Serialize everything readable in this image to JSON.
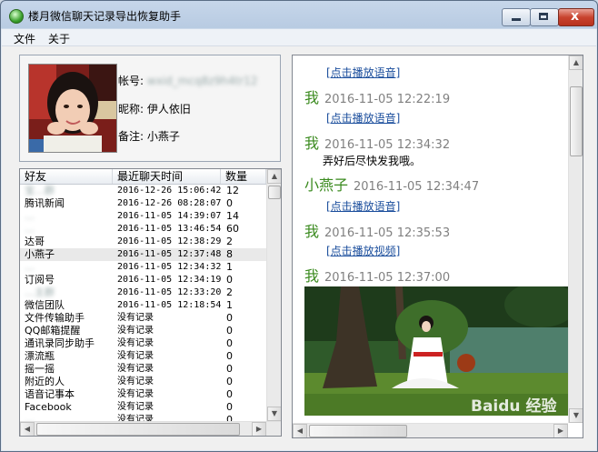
{
  "window": {
    "title": "楼月微信聊天记录导出恢复助手",
    "min_glyph": "",
    "max_glyph": "",
    "close_glyph": "x"
  },
  "menu": [
    "文件",
    "关于"
  ],
  "profile": {
    "account_label": "帐号:",
    "account_value": "wxid_mcq8z9h4tr12",
    "nickname_label": "昵称:",
    "nickname_value": "伊人依旧",
    "remark_label": "备注:",
    "remark_value": "小燕子"
  },
  "friend_list": {
    "columns": [
      "好友",
      "最近聊天时间",
      "数量"
    ],
    "rows": [
      {
        "name": "宝…群",
        "time": "2016-12-26 15:06:42",
        "count": "12",
        "blurred": true
      },
      {
        "name": "腾讯新闻",
        "time": "2016-12-26 08:28:07",
        "count": "0",
        "blurred": false
      },
      {
        "name": "…",
        "time": "2016-11-05 14:39:07",
        "count": "14",
        "blurred": true
      },
      {
        "name": "…",
        "time": "2016-11-05 13:46:54",
        "count": "60",
        "blurred": true
      },
      {
        "name": "达哥",
        "time": "2016-11-05 12:38:29",
        "count": "2",
        "blurred": false
      },
      {
        "name": "小燕子",
        "time": "2016-11-05 12:37:48",
        "count": "8",
        "blurred": false,
        "selected": true
      },
      {
        "name": "…",
        "time": "2016-11-05 12:34:32",
        "count": "1",
        "blurred": true
      },
      {
        "name": "订阅号",
        "time": "2016-11-05 12:34:19",
        "count": "0",
        "blurred": false
      },
      {
        "name": "…主群",
        "time": "2016-11-05 12:33:20",
        "count": "2",
        "blurred": true
      },
      {
        "name": "微信团队",
        "time": "2016-11-05 12:18:54",
        "count": "1",
        "blurred": false
      },
      {
        "name": "文件传输助手",
        "time": "没有记录",
        "count": "0",
        "blurred": false
      },
      {
        "name": "QQ邮箱提醒",
        "time": "没有记录",
        "count": "0",
        "blurred": false
      },
      {
        "name": "通讯录同步助手",
        "time": "没有记录",
        "count": "0",
        "blurred": false
      },
      {
        "name": "漂流瓶",
        "time": "没有记录",
        "count": "0",
        "blurred": false
      },
      {
        "name": "摇一摇",
        "time": "没有记录",
        "count": "0",
        "blurred": false
      },
      {
        "name": "附近的人",
        "time": "没有记录",
        "count": "0",
        "blurred": false
      },
      {
        "name": "语音记事本",
        "time": "没有记录",
        "count": "0",
        "blurred": false
      },
      {
        "name": "Facebook",
        "time": "没有记录",
        "count": "0",
        "blurred": false
      },
      {
        "name": "…",
        "time": "没有记录",
        "count": "0",
        "blurred": true
      }
    ]
  },
  "chat": {
    "messages": [
      {
        "type": "link",
        "text": "[点击播放语音]"
      },
      {
        "type": "header",
        "sender": "我",
        "time": "2016-11-05 12:22:19"
      },
      {
        "type": "link",
        "text": "[点击播放语音]"
      },
      {
        "type": "header",
        "sender": "我",
        "time": "2016-11-05 12:34:32"
      },
      {
        "type": "text",
        "text": "弄好后尽快发我哦。"
      },
      {
        "type": "header",
        "sender": "小燕子",
        "time": "2016-11-05 12:34:47"
      },
      {
        "type": "link",
        "text": "[点击播放语音]"
      },
      {
        "type": "header",
        "sender": "我",
        "time": "2016-11-05 12:35:53"
      },
      {
        "type": "link",
        "text": "[点击播放视频]"
      },
      {
        "type": "header",
        "sender": "我",
        "time": "2016-11-05 12:37:00"
      }
    ],
    "watermark": "Baidu 经验"
  },
  "colors": {
    "sender_green": "#3a8a1e",
    "link_blue": "#1a4d9c",
    "time_gray": "#808080"
  }
}
